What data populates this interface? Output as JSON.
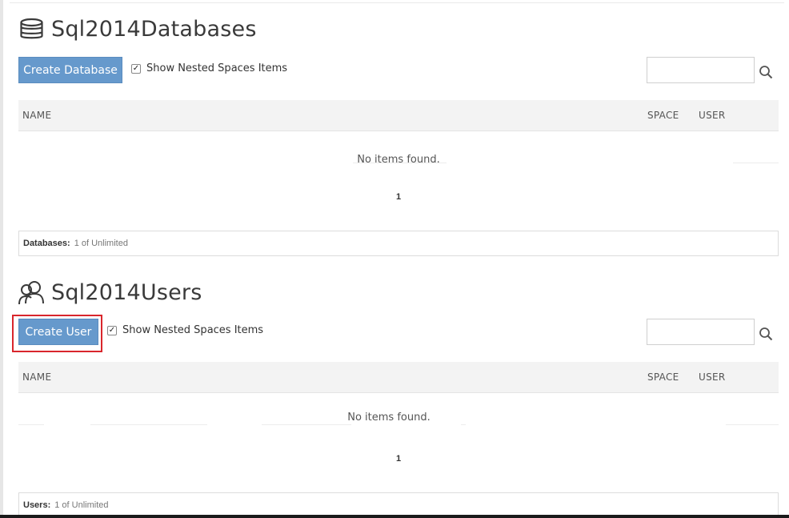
{
  "databases": {
    "title": "Sql2014Databases",
    "create_label": "Create Database",
    "nested_label": "Show Nested Spaces Items",
    "nested_check": "✓",
    "search_value": "",
    "columns": [
      "NAME",
      "SPACE",
      "USER"
    ],
    "empty_text": "No items found.",
    "page": "1",
    "quota_label": "Databases:",
    "quota_value": "1 of Unlimited"
  },
  "users": {
    "title": "Sql2014Users",
    "create_label": "Create User",
    "nested_label": "Show Nested Spaces Items",
    "nested_check": "✓",
    "search_value": "",
    "columns": [
      "NAME",
      "SPACE",
      "USER"
    ],
    "empty_text": "No items found.",
    "page": "1",
    "quota_label": "Users:",
    "quota_value": "1 of Unlimited"
  },
  "colors": {
    "button": "#6699cc",
    "highlight": "#d9262c"
  }
}
